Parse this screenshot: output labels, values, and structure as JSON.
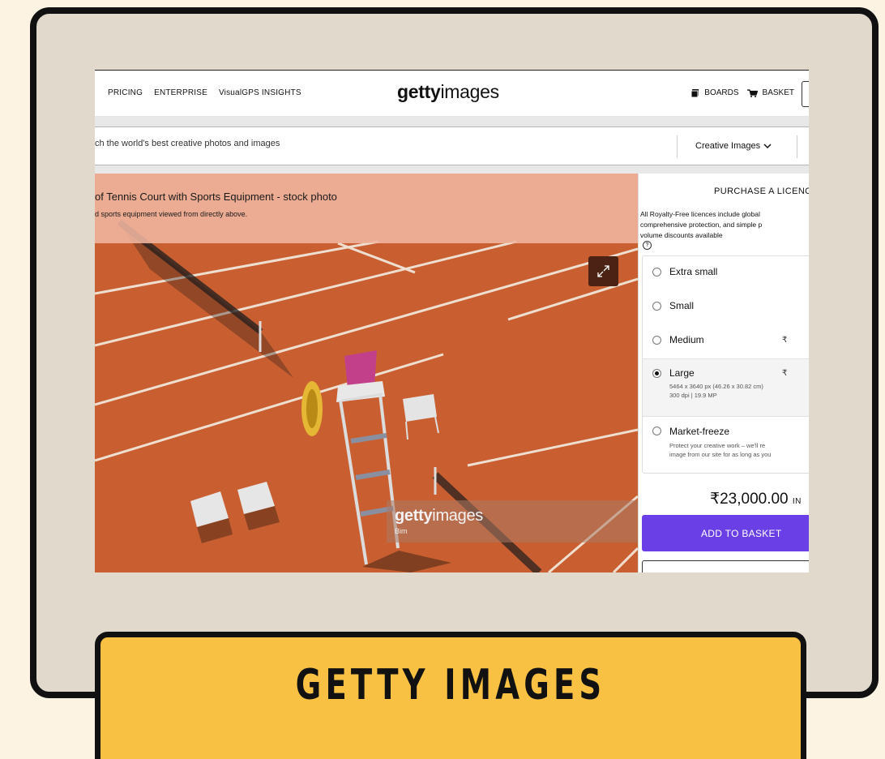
{
  "top_nav": {
    "pricing": "PRICING",
    "enterprise": "ENTERPRISE",
    "insights": "VisualGPS INSIGHTS"
  },
  "logo": {
    "bold": "getty",
    "light": "images"
  },
  "header_actions": {
    "boards": "BOARDS",
    "basket": "BASKET"
  },
  "search": {
    "placeholder": "ch the world's best creative photos and images",
    "filter_label": "Creative Images"
  },
  "image": {
    "title": "of Tennis Court with Sports Equipment - stock photo",
    "subtitle": "d sports equipment viewed from directly above.",
    "watermark": {
      "bold": "getty",
      "light": "images",
      "credit": "Bim"
    }
  },
  "purchase": {
    "title": "PURCHASE A LICENC",
    "description_lines": [
      "All Royalty-Free licences include global",
      "comprehensive protection, and simple p",
      "volume discounts available"
    ],
    "help_icon": "?",
    "options": [
      {
        "name": "Extra small",
        "price": "",
        "selected": false
      },
      {
        "name": "Small",
        "price": "",
        "selected": false
      },
      {
        "name": "Medium",
        "price": "₹",
        "selected": false
      },
      {
        "name": "Large",
        "price": "₹",
        "selected": true,
        "detail_1": "5464 x 3640 px (46.26 x 30.82 cm)",
        "detail_2": "300 dpi | 19.9 MP"
      },
      {
        "name": "Market-freeze",
        "price": "",
        "selected": false,
        "detail_1": "Protect your creative work – we'll re",
        "detail_2": "image from our site for as long as you"
      }
    ],
    "total_price": "₹23,000.00",
    "currency": "IN",
    "add_button": "ADD TO BASKET"
  },
  "banner": {
    "label": "GETTY IMAGES"
  },
  "icons": [
    "boards-icon",
    "basket-icon",
    "chevron-down-icon",
    "expand-icon",
    "help-icon",
    "radio-icon"
  ],
  "colors": {
    "banner": "#f8c143",
    "frame": "#e0d9cc",
    "background": "#fcf3e3",
    "add_button": "#6a3fe6",
    "court": "#cf6435"
  }
}
